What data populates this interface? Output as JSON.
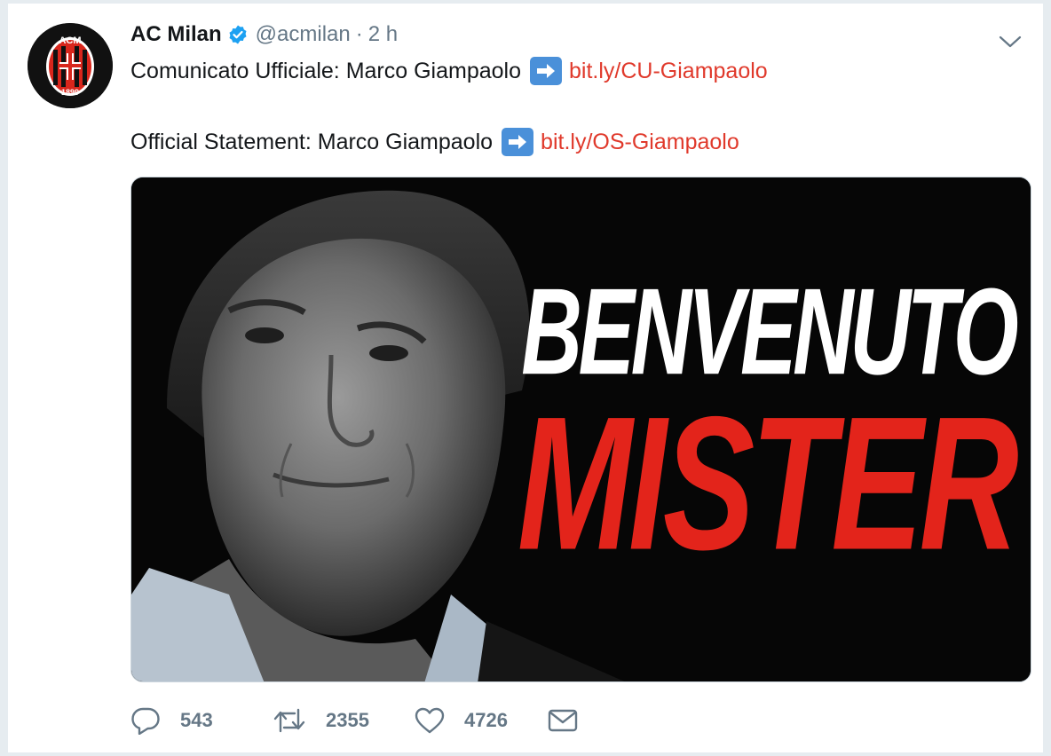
{
  "tweet": {
    "author_name": "AC Milan",
    "handle": "@acmilan",
    "separator": "·",
    "time": "2 h",
    "line1_text": "Comunicato Ufficiale: Marco Giampaolo",
    "line1_link": "bit.ly/CU-Giampaolo",
    "line2_text": "Official Statement: Marco Giampaolo",
    "line2_link": "bit.ly/OS-Giampaolo",
    "media": {
      "headline_top": "BENVENUTO",
      "headline_bottom": "MISTER"
    },
    "avatar_logo": {
      "letters": "ACM",
      "year": "1899"
    },
    "actions": {
      "replies": "543",
      "retweets": "2355",
      "likes": "4726"
    },
    "icons": {
      "verified": "verified-badge-icon",
      "more": "chevron-down-icon",
      "arrow_emoji": "right-arrow-emoji-icon",
      "reply": "reply-icon",
      "retweet": "retweet-icon",
      "like": "heart-icon",
      "dm": "envelope-icon"
    },
    "colors": {
      "link": "#e0392b",
      "verified": "#1da1f2",
      "muted": "#657786",
      "mister_red": "#e3241b"
    }
  }
}
